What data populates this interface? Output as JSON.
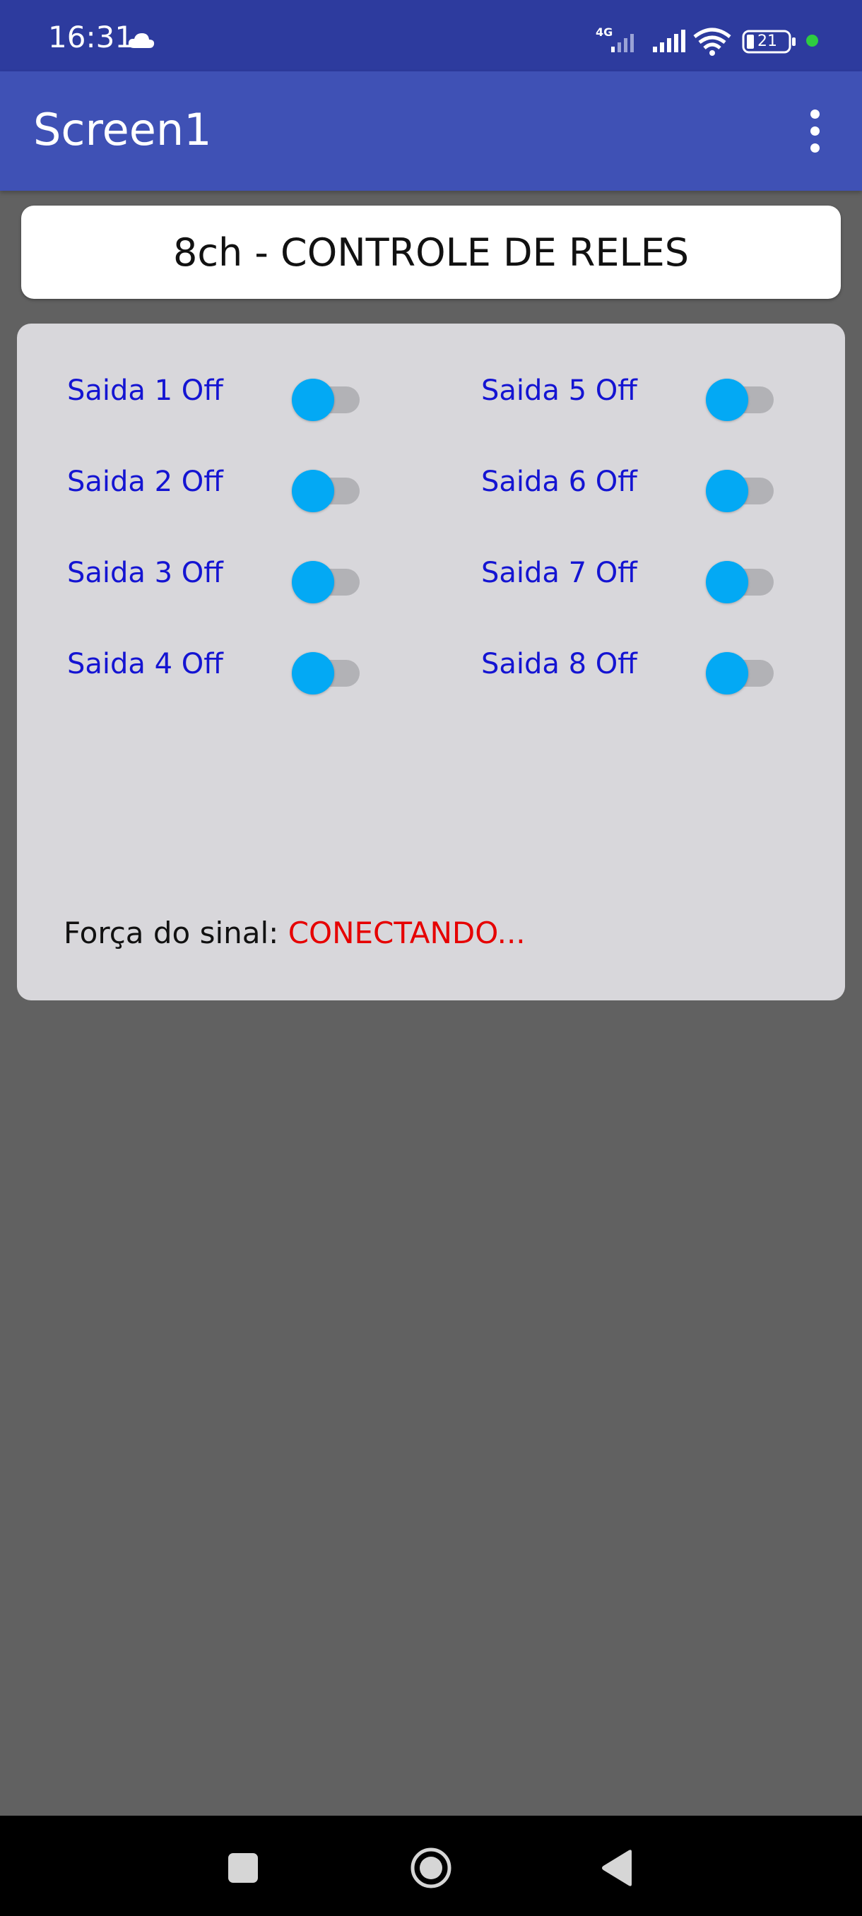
{
  "status_bar": {
    "time": "16:31",
    "network_label": "4G",
    "battery_level": "21",
    "icons": [
      "cloud-icon",
      "cell-signal-4g-icon",
      "cell-signal-icon",
      "wifi-icon",
      "battery-icon",
      "green-dot-indicator"
    ]
  },
  "app_bar": {
    "title": "Screen1",
    "menu_icon": "more-vert-icon"
  },
  "header": {
    "title": "8ch - CONTROLE DE RELES"
  },
  "relays": [
    {
      "label": "Saida 1 Off",
      "on": false
    },
    {
      "label": "Saida 2 Off",
      "on": false
    },
    {
      "label": "Saida 3 Off",
      "on": false
    },
    {
      "label": "Saida 4 Off",
      "on": false
    },
    {
      "label": "Saida 5 Off",
      "on": false
    },
    {
      "label": "Saida 6 Off",
      "on": false
    },
    {
      "label": "Saida 7 Off",
      "on": false
    },
    {
      "label": "Saida 8 Off",
      "on": false
    }
  ],
  "signal": {
    "label": "Força do sinal:",
    "value": "CONECTANDO..."
  },
  "colors": {
    "status_bar": "#2d3b9e",
    "app_bar": "#3f51b5",
    "background": "#616161",
    "panel": "#d8d7db",
    "relay_label": "#1414d2",
    "switch_thumb": "#03a9f4",
    "switch_track": "#b2b2b6",
    "signal_value": "#e60000"
  },
  "nav_bar": {
    "buttons": [
      "recents-button",
      "home-button",
      "back-button"
    ]
  }
}
